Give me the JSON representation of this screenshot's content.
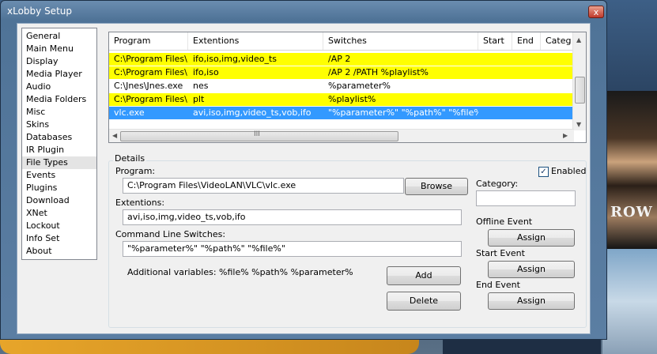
{
  "window": {
    "title": "xLobby Setup",
    "close_glyph": "x"
  },
  "background": {
    "poster_text": "ROW"
  },
  "nav": {
    "items": [
      "General",
      "Main Menu",
      "Display",
      "Media Player",
      "Audio",
      "Media Folders",
      "Misc",
      "Skins",
      "Databases",
      "IR Plugin",
      "File Types",
      "Events",
      "Plugins",
      "Download",
      "XNet",
      "Lockout",
      "Info Set",
      "About"
    ],
    "selected": "File Types"
  },
  "file_list": {
    "columns": [
      "Program",
      "Extentions",
      "Switches",
      "Start",
      "End",
      "Categ"
    ],
    "rows": [
      {
        "program": "C:\\Program Files\\...",
        "extentions": "ifo,iso,img,video_ts",
        "switches": "/AP 2",
        "start": "",
        "end": "",
        "category": "",
        "highlight": "yellow"
      },
      {
        "program": "C:\\Program Files\\...",
        "extentions": "ifo,iso",
        "switches": "/AP 2 /PATH %playlist%",
        "start": "",
        "end": "",
        "category": "",
        "highlight": "yellow"
      },
      {
        "program": "C:\\Jnes\\Jnes.exe",
        "extentions": "nes",
        "switches": "%parameter%",
        "start": "",
        "end": "",
        "category": "",
        "highlight": "none"
      },
      {
        "program": "C:\\Program Files\\...",
        "extentions": "plt",
        "switches": "%playlist%",
        "start": "",
        "end": "",
        "category": "",
        "highlight": "yellow"
      },
      {
        "program": "vlc.exe",
        "extentions": "avi,iso,img,video_ts,vob,ifo",
        "switches": "\"%parameter%\" \"%path%\" \"%file%\"",
        "start": "",
        "end": "",
        "category": "",
        "highlight": "selected"
      }
    ],
    "hscroll_grip": "III"
  },
  "details": {
    "group_label": "Details",
    "program_label": "Program:",
    "program_value": "C:\\Program Files\\VideoLAN\\VLC\\vlc.exe",
    "browse_label": "Browse",
    "extentions_label": "Extentions:",
    "extentions_value": "avi,iso,img,video_ts,vob,ifo",
    "switches_label": "Command Line Switches:",
    "switches_value": "\"%parameter%\" \"%path%\" \"%file%\"",
    "additional_vars": "Additional variables:  %file%  %path%  %parameter%",
    "add_label": "Add",
    "delete_label": "Delete",
    "enabled_label": "Enabled",
    "enabled_checked": true,
    "category_label": "Category:",
    "category_value": "",
    "offline_event_label": "Offline Event",
    "start_event_label": "Start Event",
    "end_event_label": "End Event",
    "assign_label": "Assign"
  },
  "colors": {
    "row_highlight": "#ffff00",
    "row_selected": "#3399ff"
  }
}
